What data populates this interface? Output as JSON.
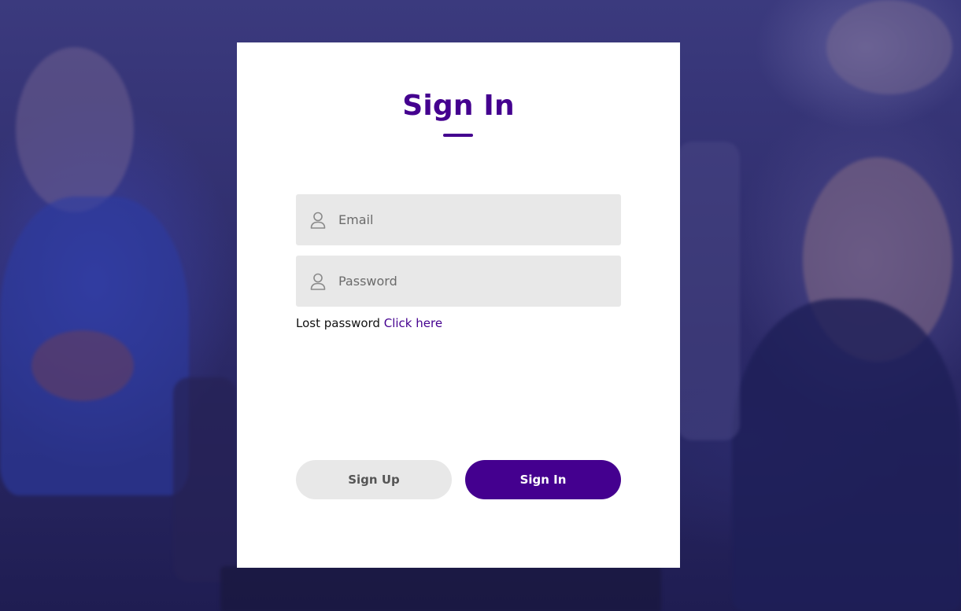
{
  "page": {
    "title": "Sign In"
  },
  "form": {
    "email": {
      "value": "",
      "placeholder": "Email",
      "icon": "user-icon"
    },
    "password": {
      "value": "",
      "placeholder": "Password",
      "icon": "user-icon"
    },
    "lost_password_text": "Lost password",
    "lost_password_link": "Click here"
  },
  "buttons": {
    "sign_up": "Sign Up",
    "sign_in": "Sign In"
  },
  "colors": {
    "accent": "#44008f",
    "field_background": "#e8e8e8",
    "card_background": "#ffffff",
    "overlay": "#2e2a6e"
  }
}
